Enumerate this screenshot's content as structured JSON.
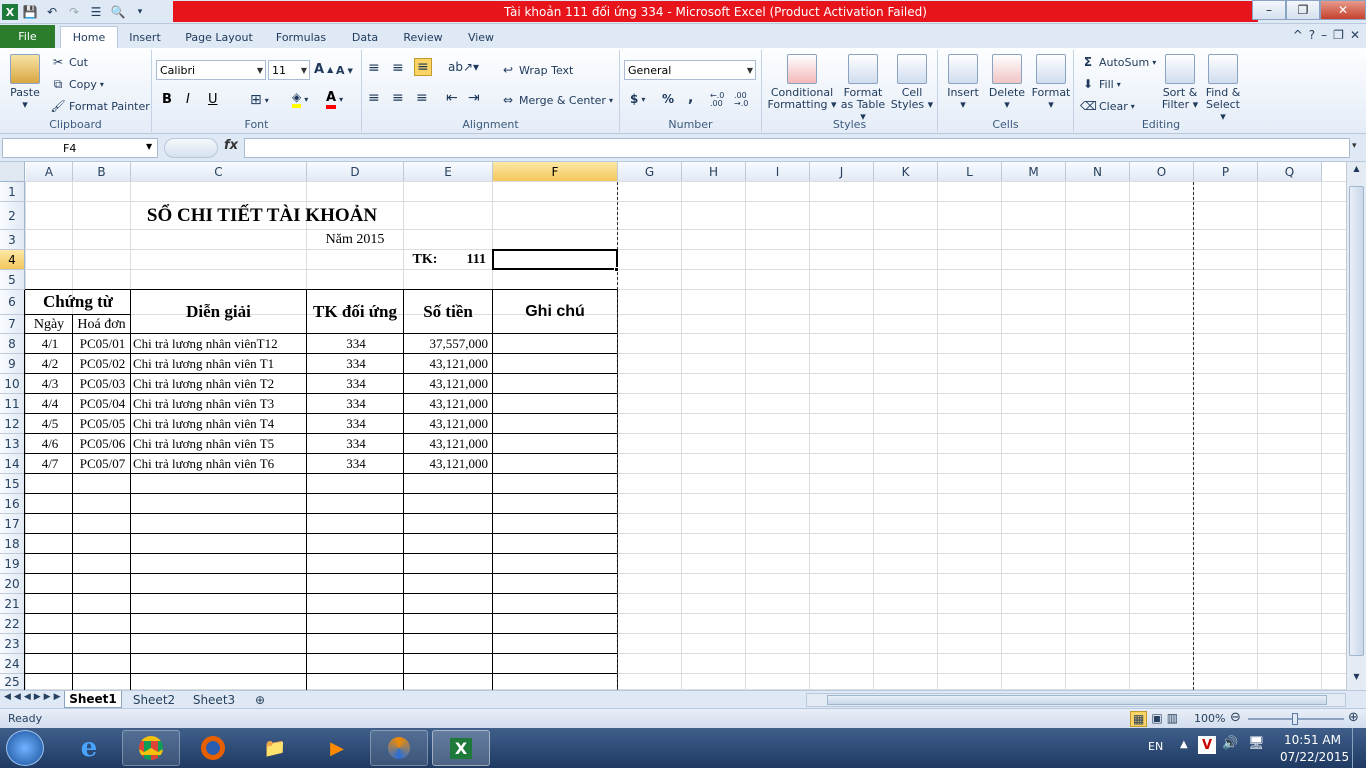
{
  "window": {
    "title": "Tài khoản 111 đối ứng 334  -  Microsoft Excel (Product Activation Failed)",
    "app_icon": "X"
  },
  "ribbon_tabs": [
    "File",
    "Home",
    "Insert",
    "Page Layout",
    "Formulas",
    "Data",
    "Review",
    "View"
  ],
  "clipboard": {
    "paste": "Paste",
    "cut": "Cut",
    "copy": "Copy",
    "format_painter": "Format Painter",
    "label": "Clipboard"
  },
  "font": {
    "name": "Calibri",
    "size": "11",
    "bold": "B",
    "italic": "I",
    "underline": "U",
    "label": "Font"
  },
  "alignment": {
    "wrap": "Wrap Text",
    "merge": "Merge & Center",
    "label": "Alignment"
  },
  "number": {
    "format": "General",
    "currency": "$",
    "percent": "%",
    "comma": ",",
    "inc_dec": "←.0 .00",
    "dec_dec": ".00 →.0",
    "label": "Number"
  },
  "styles": {
    "conditional_line1": "Conditional",
    "conditional_line2": "Formatting",
    "table_line1": "Format",
    "table_line2": "as Table",
    "cell_line1": "Cell",
    "cell_line2": "Styles",
    "label": "Styles"
  },
  "cells_group": {
    "insert": "Insert",
    "delete": "Delete",
    "format": "Format",
    "label": "Cells"
  },
  "editing": {
    "autosum": "AutoSum",
    "fill": "Fill",
    "clear": "Clear",
    "sort_line1": "Sort &",
    "sort_line2": "Filter",
    "find_line1": "Find &",
    "find_line2": "Select",
    "label": "Editing"
  },
  "formula_bar": {
    "name_box": "F4",
    "fx": "fx",
    "value": ""
  },
  "columns": [
    "A",
    "B",
    "C",
    "D",
    "E",
    "F",
    "G",
    "H",
    "I",
    "J",
    "K",
    "L",
    "M",
    "N",
    "O",
    "P",
    "Q"
  ],
  "rows": [
    "1",
    "2",
    "3",
    "4",
    "5",
    "6",
    "7",
    "8",
    "9",
    "10",
    "11",
    "12",
    "13",
    "14",
    "15",
    "16",
    "17",
    "18",
    "19",
    "20",
    "21",
    "22",
    "23",
    "24",
    "25"
  ],
  "sheet": {
    "title": "SỔ CHI TIẾT TÀI KHOẢN",
    "year": "Năm 2015",
    "tk_label": "TK:",
    "tk_value": "111",
    "header_chungtu": "Chứng từ",
    "header_ngay": "Ngày",
    "header_hoadon": "Hoá đơn",
    "header_diengiai": "Diễn giải",
    "header_tkdoiung": "TK đối ứng",
    "header_sotien": "Số tiền",
    "header_ghichu": "Ghi chú",
    "records": [
      {
        "ngay": "4/1",
        "hoadon": "PC05/01",
        "diengiai": "Chi trả lương nhân viênT12",
        "tk": "334",
        "sotien": "37,557,000"
      },
      {
        "ngay": "4/2",
        "hoadon": "PC05/02",
        "diengiai": "Chi trả lương nhân viên T1",
        "tk": "334",
        "sotien": "43,121,000"
      },
      {
        "ngay": "4/3",
        "hoadon": "PC05/03",
        "diengiai": "Chi trả lương nhân viên T2",
        "tk": "334",
        "sotien": "43,121,000"
      },
      {
        "ngay": "4/4",
        "hoadon": "PC05/04",
        "diengiai": "Chi trả lương nhân viên T3",
        "tk": "334",
        "sotien": "43,121,000"
      },
      {
        "ngay": "4/5",
        "hoadon": "PC05/05",
        "diengiai": "Chi trả lương nhân viên T4",
        "tk": "334",
        "sotien": "43,121,000"
      },
      {
        "ngay": "4/6",
        "hoadon": "PC05/06",
        "diengiai": "Chi trả lương nhân viên T5",
        "tk": "334",
        "sotien": "43,121,000"
      },
      {
        "ngay": "4/7",
        "hoadon": "PC05/07",
        "diengiai": "Chi trả lương nhân viên T6",
        "tk": "334",
        "sotien": "43,121,000"
      }
    ]
  },
  "sheet_tabs": [
    "Sheet1",
    "Sheet2",
    "Sheet3"
  ],
  "status": {
    "ready": "Ready",
    "zoom": "100%"
  },
  "taskbar": {
    "lang": "EN",
    "time": "10:51 AM",
    "date": "07/22/2015"
  }
}
